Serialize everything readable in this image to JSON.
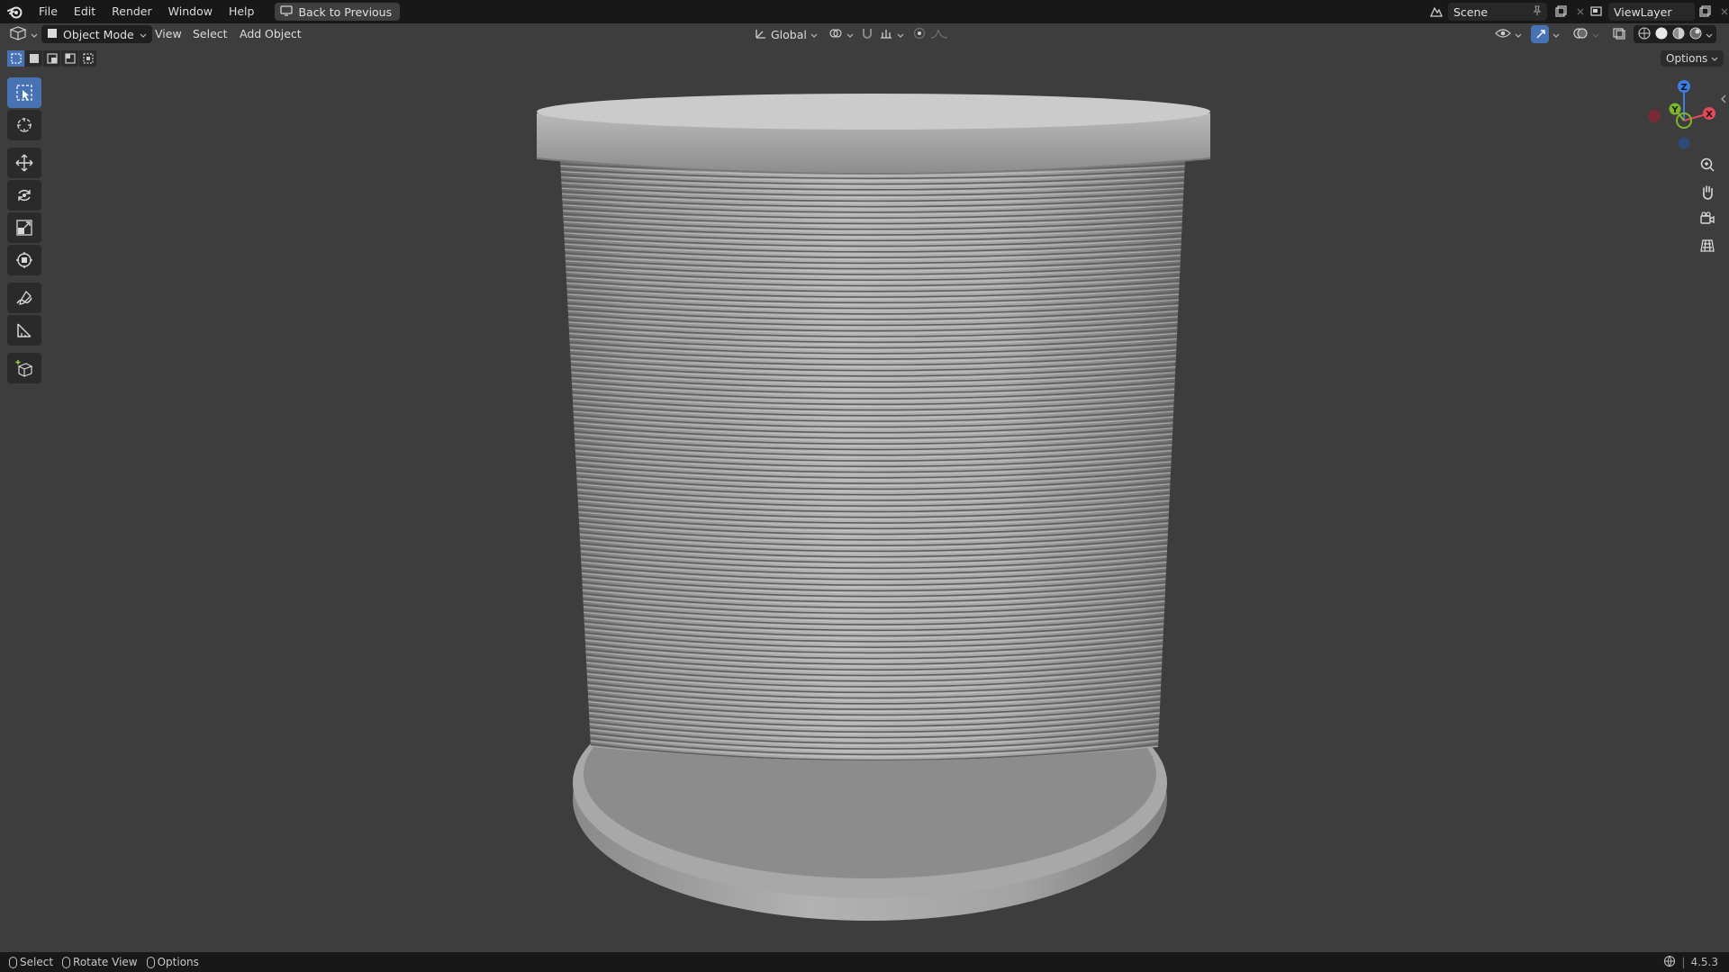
{
  "menubar": {
    "items": [
      "File",
      "Edit",
      "Render",
      "Window",
      "Help"
    ],
    "back_button": "Back to Previous",
    "scene_name": "Scene",
    "view_layer": "ViewLayer"
  },
  "viewport_header": {
    "mode": "Object Mode",
    "menus": [
      "View",
      "Select",
      "Add",
      "Object"
    ],
    "transform_orientation": "Global"
  },
  "overlay": {
    "options_label": "Options",
    "gizmo_axes": {
      "x": "X",
      "y": "Y",
      "z": "Z"
    }
  },
  "statusbar": {
    "select": "Select",
    "rotate_view": "Rotate View",
    "options": "Options",
    "version": "4.5.3"
  },
  "colors": {
    "accent": "#4772b3",
    "axis_x": "#e24a5a",
    "axis_y": "#7fb52a",
    "axis_z": "#3b7fe0",
    "background": "#3d3d3d",
    "bar": "#181818"
  }
}
